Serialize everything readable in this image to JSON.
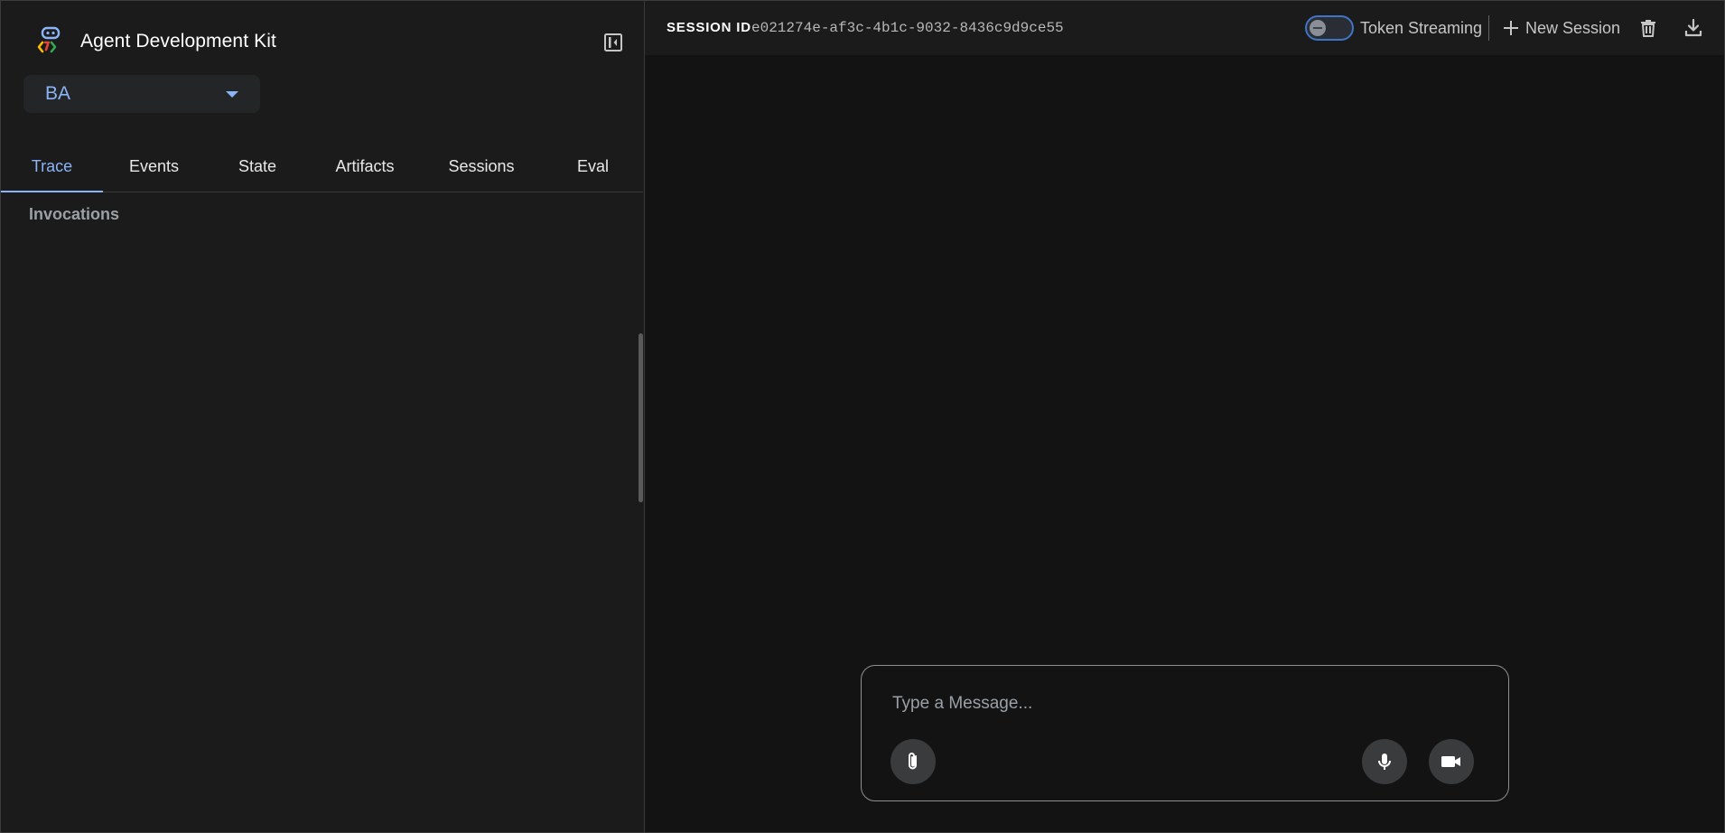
{
  "app": {
    "title": "Agent Development Kit",
    "accent_color": "#8ab4f8",
    "logo_icon": "adk-logo-icon"
  },
  "sidebar": {
    "collapse_icon": "dock-left-icon",
    "agent_select": {
      "value": "BA",
      "caret_icon": "arrow-drop-down-icon"
    },
    "tabs": [
      {
        "label": "Trace",
        "active": true
      },
      {
        "label": "Events",
        "active": false
      },
      {
        "label": "State",
        "active": false
      },
      {
        "label": "Artifacts",
        "active": false
      },
      {
        "label": "Sessions",
        "active": false
      },
      {
        "label": "Eval",
        "active": false
      }
    ],
    "section_label": "Invocations"
  },
  "header": {
    "session_label": "SESSION ID",
    "session_id": "e021274e-af3c-4b1c-9032-8436c9d9ce55",
    "token_streaming": {
      "label": "Token Streaming",
      "enabled": false
    },
    "new_session_label": "New Session",
    "delete_icon": "trash-icon",
    "download_icon": "download-icon"
  },
  "composer": {
    "placeholder": "Type a Message...",
    "value": "",
    "attach_icon": "paperclip-icon",
    "mic_icon": "microphone-icon",
    "camera_icon": "videocam-icon"
  }
}
